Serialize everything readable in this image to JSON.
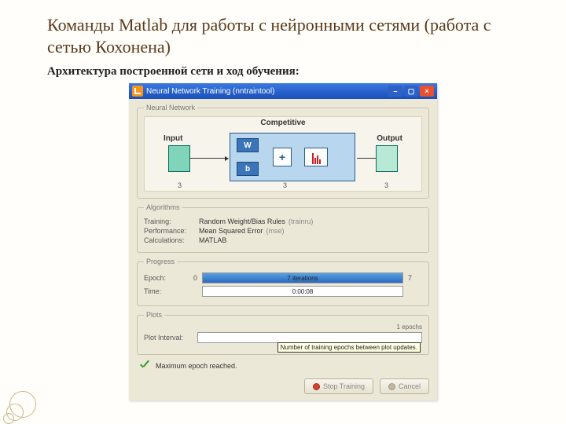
{
  "slide": {
    "title": "Команды Matlab для работы с нейронными сетями (работа с сетью Кохонена)",
    "subtitle": "Архитектура построенной сети и ход обучения:"
  },
  "window": {
    "title": "Neural Network Training (nntraintool)"
  },
  "groups": {
    "nn": "Neural Network",
    "alg": "Algorithms",
    "prog": "Progress",
    "plots": "Plots"
  },
  "diagram": {
    "competitive": "Competitive",
    "input": "Input",
    "output": "Output",
    "w": "W",
    "b": "b",
    "plus": "+",
    "size_in": "3",
    "size_layer": "3",
    "size_out": "3"
  },
  "alg": {
    "training_k": "Training:",
    "training_v": "Random Weight/Bias Rules",
    "training_g": "(trainru)",
    "perf_k": "Performance:",
    "perf_v": "Mean Squared Error",
    "perf_g": "(mse)",
    "calc_k": "Calculations:",
    "calc_v": "MATLAB"
  },
  "progress": {
    "epoch_k": "Epoch:",
    "epoch_lo": "0",
    "epoch_txt": "7 iterations",
    "epoch_hi": "7",
    "time_k": "Time:",
    "time_txt": "0:00:08"
  },
  "plots": {
    "interval_k": "Plot Interval:",
    "epochs_lbl": "1 epochs",
    "tooltip": "Number of training epochs between plot updates."
  },
  "status": "Maximum epoch reached.",
  "buttons": {
    "stop": "Stop Training",
    "cancel": "Cancel"
  }
}
